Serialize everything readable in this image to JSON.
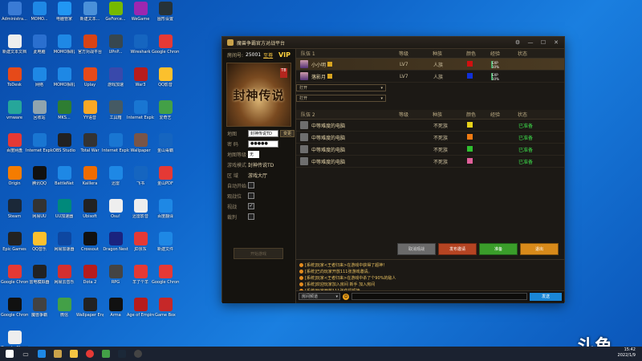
{
  "desktop": {
    "icons": [
      {
        "label": "Administra...",
        "color": "#3a7bd5"
      },
      {
        "label": "MOMO...",
        "color": "#1e88e5"
      },
      {
        "label": "电脑管家",
        "color": "#2196f3"
      },
      {
        "label": "新建文本...",
        "color": "#4a90d9"
      },
      {
        "label": "GeForce...",
        "color": "#76b900"
      },
      {
        "label": "WeGame",
        "color": "#9c27b0"
      },
      {
        "label": "图形设置",
        "color": "#263238"
      },
      {
        "label": "新建文本文档",
        "color": "#eeeeee"
      },
      {
        "label": "此电脑",
        "color": "#2a6fcf"
      },
      {
        "label": "MOMO相机",
        "color": "#1e88e5"
      },
      {
        "label": "官方对战平台",
        "color": "#d84315"
      },
      {
        "label": "UPnP...",
        "color": "#37474f"
      },
      {
        "label": "Wireshark",
        "color": "#1565c0"
      },
      {
        "label": "Google Chrome",
        "color": "#e53935"
      },
      {
        "label": "ToDesk",
        "color": "#e64a19"
      },
      {
        "label": "网络",
        "color": "#1e88e5"
      },
      {
        "label": "MOMO相机",
        "color": "#1e88e5"
      },
      {
        "label": "Uplay",
        "color": "#e64a19"
      },
      {
        "label": "游戏加速",
        "color": "#3949ab"
      },
      {
        "label": "War3",
        "color": "#b71c1c"
      },
      {
        "label": "QQ影音",
        "color": "#fbc02d"
      },
      {
        "label": "vmware",
        "color": "#26a69a"
      },
      {
        "label": "回收站",
        "color": "#90a4ae"
      },
      {
        "label": "MKS...",
        "color": "#2e7d32"
      },
      {
        "label": "YY语音",
        "color": "#f9a825"
      },
      {
        "label": "工具箱",
        "color": "#455a64"
      },
      {
        "label": "Internet Explorer",
        "color": "#1976d2"
      },
      {
        "label": "爱奇艺",
        "color": "#43a047"
      },
      {
        "label": "百度网盘",
        "color": "#e53935"
      },
      {
        "label": "Internet Explorer",
        "color": "#1976d2"
      },
      {
        "label": "OBS Studio",
        "color": "#212121"
      },
      {
        "label": "Total War",
        "color": "#333333"
      },
      {
        "label": "Internet Explorer",
        "color": "#1976d2"
      },
      {
        "label": "Wallpaper",
        "color": "#795548"
      },
      {
        "label": "金山毒霸",
        "color": "#1565c0"
      },
      {
        "label": "Origin",
        "color": "#f57c00"
      },
      {
        "label": "腾讯QQ",
        "color": "#111111"
      },
      {
        "label": "BattleNet",
        "color": "#1e88e5"
      },
      {
        "label": "Kaillera",
        "color": "#ef6c00"
      },
      {
        "label": "迅雷",
        "color": "#1e88e5"
      },
      {
        "label": "飞书",
        "color": "#1565c0"
      },
      {
        "label": "金山PDF",
        "color": "#e53935"
      },
      {
        "label": "Steam",
        "color": "#1b2838"
      },
      {
        "label": "网易UU",
        "color": "#333333"
      },
      {
        "label": "UU加速器",
        "color": "#00897b"
      },
      {
        "label": "Ubisoft",
        "color": "#222222"
      },
      {
        "label": "Osu!",
        "color": "#eeeeee"
      },
      {
        "label": "迅雷影音",
        "color": "#eeeeee"
      },
      {
        "label": "百度翻译",
        "color": "#1e88e5"
      },
      {
        "label": "Epic Games",
        "color": "#222222"
      },
      {
        "label": "QQ音乐",
        "color": "#fbc02d"
      },
      {
        "label": "网易加速器",
        "color": "#0d47a1"
      },
      {
        "label": "Crossout",
        "color": "#111111"
      },
      {
        "label": "Dragon Nest",
        "color": "#1a237e"
      },
      {
        "label": "JD京东",
        "color": "#e53935"
      },
      {
        "label": "新建文件",
        "color": "#1e88e5"
      },
      {
        "label": "Google Chrome",
        "color": "#e53935"
      },
      {
        "label": "雷电模拟器",
        "color": "#222222"
      },
      {
        "label": "网易云音乐",
        "color": "#d32f2f"
      },
      {
        "label": "Dota 2",
        "color": "#b71c1c"
      },
      {
        "label": "RPG",
        "color": "#444444"
      },
      {
        "label": "羊了个羊",
        "color": "#e53935"
      },
      {
        "label": "Google Chrome",
        "color": "#e53935"
      },
      {
        "label": "Google Chrome",
        "color": "#111111"
      },
      {
        "label": "魔兽争霸",
        "color": "#424242"
      },
      {
        "label": "微信",
        "color": "#43a047"
      },
      {
        "label": "Wallpaper Engine",
        "color": "#222222"
      },
      {
        "label": "Arma",
        "color": "#111111"
      },
      {
        "label": "Age of Empires",
        "color": "#b71c1c"
      },
      {
        "label": "Game Box",
        "color": "#c62828"
      },
      {
        "label": "Google Chrome",
        "color": "#eeeeee"
      }
    ]
  },
  "window": {
    "title": "魔兽争霸官方对战平台",
    "room_label": "房间号:",
    "room_number": "25001",
    "room_level": "至尊",
    "vip": "VIP",
    "banner_text": "封神传说",
    "banner_badge": "T8",
    "fields": {
      "map_label": "地图",
      "map_value": "封神传说TD",
      "map_button": "变更",
      "pwd_label": "密 码",
      "pwd_value": "●●●●●",
      "host_label": "地图等级",
      "host_value": "无",
      "mode_label": "游戏模式",
      "mode_value": "封神传说TD",
      "area_label": "区 域",
      "area_value": "游戏大厅",
      "opt1_label": "自动开始",
      "opt2_label": "观战位",
      "opt3_label": "视战",
      "opt4_label": "裁判",
      "left_button": "开始游戏"
    },
    "team1": {
      "label": "队伍 1",
      "headers": {
        "level": "等级",
        "race": "种族",
        "color": "颜色",
        "exp": "经验",
        "status": "状态"
      },
      "players": [
        {
          "name": "小小明",
          "level": "LV7",
          "race": "人族",
          "color": "#d01010",
          "exp": "EXP 10%",
          "exp_pct": 0.1,
          "status": ""
        },
        {
          "name": "落影月",
          "level": "LV7",
          "race": "人族",
          "color": "#1030d8",
          "exp": "EXP 10%",
          "exp_pct": 0.1,
          "status": ""
        }
      ],
      "open_slots": [
        "打开",
        "打开"
      ]
    },
    "team2": {
      "label": "队伍 2",
      "headers": {
        "level": "等级",
        "race": "种族",
        "color": "颜色",
        "exp": "经验",
        "status": "状态"
      },
      "players": [
        {
          "name": "中等难度的电脑",
          "race": "不死族",
          "color": "#e6d11a",
          "status": "已准备"
        },
        {
          "name": "中等难度的电脑",
          "race": "不死族",
          "color": "#f07a12",
          "status": "已准备"
        },
        {
          "name": "中等难度的电脑",
          "race": "不死族",
          "color": "#2fbf2f",
          "status": "已准备"
        },
        {
          "name": "中等难度的电脑",
          "race": "不死族",
          "color": "#e0609a",
          "status": "已准备"
        }
      ]
    },
    "actions": {
      "a1": "取消观战",
      "a2": "发布邀请",
      "a3": "准备",
      "a4": "退出"
    },
    "chat": {
      "lines": [
        "[系统]玩家<王者归来>在游戏中获得了超神！",
        "[系统]已向玩家开放111张游戏邀请。",
        "[系统]玩家<王者归来>在游戏中杀了个90%的敌人",
        "[系统]欢迎玩家加入房间 新手 加入房间",
        "[系统]玩家开放111张获得超神。"
      ],
      "channel": "房间频道",
      "send": "发送"
    }
  },
  "taskbar": {
    "time": "15:42",
    "date": "2022/1/9"
  },
  "watermark": "斗鱼"
}
